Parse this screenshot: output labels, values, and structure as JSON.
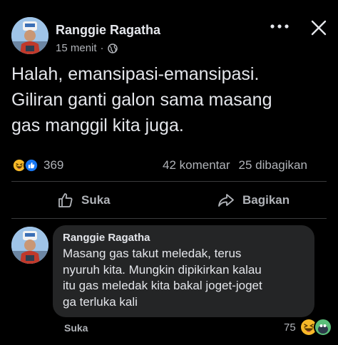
{
  "post": {
    "author": "Ranggie Ragatha",
    "time": "15 menit",
    "separator": "·",
    "text_lines": [
      "Halah, emansipasi-emansipasi.",
      "Giliran ganti galon sama masang",
      "gas manggil kita juga."
    ],
    "reaction_count": "369",
    "comments_count": "42 komentar",
    "shares_count": "25 dibagikan"
  },
  "actions": {
    "like_label": "Suka",
    "share_label": "Bagikan"
  },
  "comment": {
    "author": "Ranggie Ragatha",
    "text_lines": [
      "Masang gas takut meledak, terus",
      "nyuruh kita. Mungkin dipikirkan kalau",
      "itu gas meledak kita bakal joget-joget",
      "ga terluka kali"
    ],
    "like_label": "Suka",
    "reaction_count": "75"
  },
  "colors": {
    "background": "#000000",
    "text_primary": "#e4e6eb",
    "text_secondary": "#b0b3b8",
    "bubble": "#242526",
    "like_blue": "#1877f2",
    "haha_yellow": "#f7b928"
  },
  "icons": {
    "more": "more-dots-icon",
    "close": "close-icon",
    "audience": "globe-icon",
    "like": "thumbs-up-icon",
    "share": "share-arrow-icon"
  }
}
